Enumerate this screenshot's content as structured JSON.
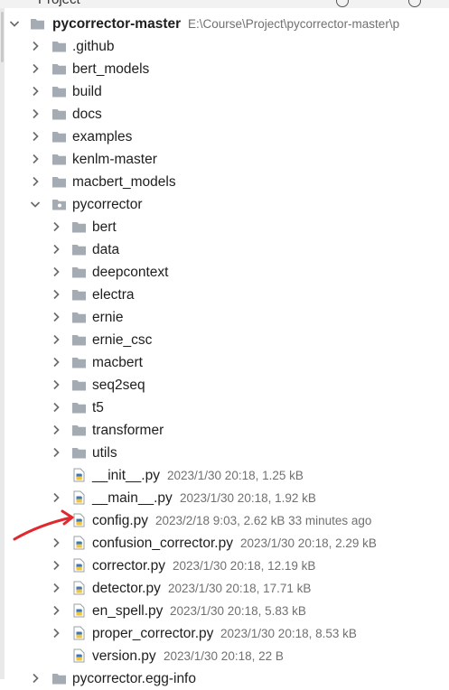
{
  "panel": {
    "title": "Project"
  },
  "tree": {
    "root": {
      "name": "pycorrector-master",
      "path": "E:\\Course\\Project\\pycorrector-master\\p"
    },
    "top_folders": [
      ".github",
      "bert_models",
      "build",
      "docs",
      "examples",
      "kenlm-master",
      "macbert_models"
    ],
    "package": {
      "name": "pycorrector"
    },
    "subfolders": [
      "bert",
      "data",
      "deepcontext",
      "electra",
      "ernie",
      "ernie_csc",
      "macbert",
      "seq2seq",
      "t5",
      "transformer",
      "utils"
    ],
    "files": [
      {
        "name": "__init__.py",
        "meta": "2023/1/30 20:18, 1.25 kB"
      },
      {
        "name": "__main__.py",
        "meta": "2023/1/30 20:18, 1.92 kB"
      },
      {
        "name": "config.py",
        "meta": "2023/2/18 9:03, 2.62 kB 33 minutes ago"
      },
      {
        "name": "confusion_corrector.py",
        "meta": "2023/1/30 20:18, 2.29 kB"
      },
      {
        "name": "corrector.py",
        "meta": "2023/1/30 20:18, 12.19 kB"
      },
      {
        "name": "detector.py",
        "meta": "2023/1/30 20:18, 17.71 kB"
      },
      {
        "name": "en_spell.py",
        "meta": "2023/1/30 20:18, 5.83 kB"
      },
      {
        "name": "proper_corrector.py",
        "meta": "2023/1/30 20:18, 8.53 kB"
      },
      {
        "name": "version.py",
        "meta": "2023/1/30 20:18, 22 B"
      }
    ],
    "next_folder": {
      "name": "pycorrector.egg-info"
    }
  },
  "colors": {
    "folder": "#a5abb3",
    "python_blue": "#3f77b5",
    "python_yellow": "#f2c33d",
    "annotation": "#e0282e"
  },
  "icons": {
    "expand": "chevron-right-icon",
    "collapse": "chevron-down-icon",
    "folder": "folder-icon",
    "package": "package-folder-icon",
    "python": "python-file-icon"
  }
}
